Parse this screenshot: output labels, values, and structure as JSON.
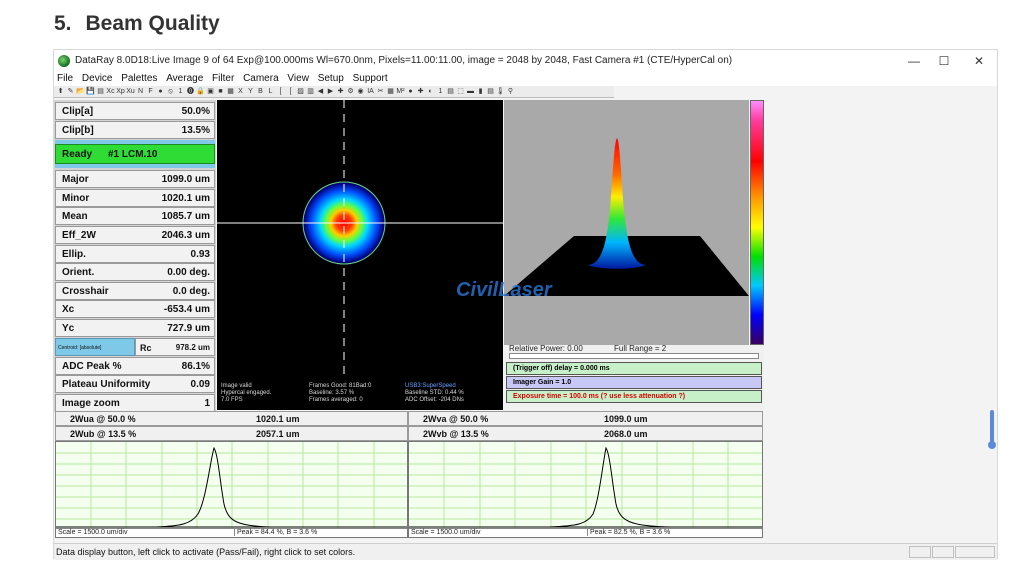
{
  "section": {
    "number": "5.",
    "title": "Beam Quality"
  },
  "window": {
    "title": "DataRay 8.0D18:Live Image 9 of 64    Exp@100.000ms     Wl=670.0nm, Pixels=11.00:11.00, image = 2048 by 2048, Fast   Camera #1  (CTE/HyperCal on)",
    "minimize": "—",
    "maximize": "☐",
    "close": "✕"
  },
  "menu": [
    "File",
    "Device",
    "Palettes",
    "Average",
    "Filter",
    "Camera",
    "View",
    "Setup",
    "Support"
  ],
  "toolbar_icons": [
    "arrow-up-icon",
    "pencil-icon",
    "open-icon",
    "save-icon",
    "print-icon",
    "xc-icon",
    "xp-icon",
    "xu-icon",
    "n-icon",
    "f-icon",
    "record-icon",
    "stop-icon",
    "one-icon",
    "info-icon",
    "lock-icon",
    "camera-icon",
    "green-square-icon",
    "grid-icon",
    "x-icon",
    "y-icon",
    "b-icon",
    "l-icon",
    "bracket-icon",
    "bracket2-icon",
    "image-icon",
    "chart-icon",
    "back-icon",
    "forward-icon",
    "plus-icon",
    "tools-icon",
    "circle-icon",
    "ia-icon",
    "cut-icon",
    "grid2-icon",
    "m2-icon",
    "red-icon",
    "target-icon",
    "beam-icon",
    "one2-icon",
    "meter-icon",
    "select-icon",
    "palette-icon",
    "bars-icon",
    "stack-icon",
    "thermo-icon",
    "pin-icon"
  ],
  "toolbar_glyphs": [
    "⬆",
    "✎",
    "📂",
    "💾",
    "▤",
    "Xc",
    "Xp",
    "Xu",
    "N",
    "F",
    "●",
    "⦸",
    "1",
    "⓿",
    "🔒",
    "▣",
    "■",
    "▦",
    "X",
    "Y",
    "B",
    "L",
    "[",
    "[",
    "▨",
    "▥",
    "◀",
    "▶",
    "✚",
    "⚙",
    "◉",
    "IA",
    "✂",
    "▦",
    "M²",
    "●",
    "✚",
    "◐",
    "1",
    "▤",
    "⬚",
    "▬",
    "▮",
    "▤",
    "🌡",
    "⚲"
  ],
  "results": [
    {
      "label": "Clip[a]",
      "value": "50.0%"
    },
    {
      "label": "Clip[b]",
      "value": "13.5%"
    }
  ],
  "status": {
    "label": "Ready",
    "detail": "#1 LCM.10"
  },
  "measurements": [
    {
      "label": "Major",
      "value": "1099.0 um"
    },
    {
      "label": "Minor",
      "value": "1020.1 um"
    },
    {
      "label": "Mean",
      "value": "1085.7 um"
    },
    {
      "label": "Eff_2W",
      "value": "2046.3 um"
    },
    {
      "label": "Ellip.",
      "value": "0.93"
    },
    {
      "label": "Orient.",
      "value": "0.00 deg."
    },
    {
      "label": "Crosshair",
      "value": "0.0 deg."
    },
    {
      "label": "Xc",
      "value": "-653.4 um"
    },
    {
      "label": "Yc",
      "value": "727.9 um"
    }
  ],
  "centroid": {
    "label": "Centroid: [absolute]",
    "rc_label": "Rc",
    "rc_value": "978.2 um"
  },
  "extra": [
    {
      "label": "ADC Peak %",
      "value": "86.1%"
    },
    {
      "label": "Plateau Uniformity",
      "value": "0.09"
    },
    {
      "label": "Image zoom",
      "value": "1"
    }
  ],
  "image_stats": {
    "col1": [
      "Image valid",
      "Hypercal engaged.",
      "7.0 FPS"
    ],
    "col2": [
      "Frames Good: 81Bad:0",
      "Baseline: 3.57 %",
      "Frames averaged: 0"
    ],
    "col3": [
      "USB3:SuperSpeed",
      "Baseline STD:  0.44 %",
      "ADC Offset: -204 DNs"
    ]
  },
  "watermark": "CivilLaser",
  "power": {
    "relative": "Relative Power: 0.00",
    "full_range": "Full Range = 2"
  },
  "controls": {
    "trigger": "(Trigger off) delay = 0.000 ms",
    "gain": "Imager Gain = 1.0",
    "exposure": "Exposure time = 100.0 ms    (?  use less attenuation ?)"
  },
  "widths": [
    {
      "label": "2Wua @ 50.0 %",
      "value": "1020.1 um"
    },
    {
      "label": "2Wub @ 13.5 %",
      "value": "2057.1 um"
    },
    {
      "label": "2Wva @ 50.0 %",
      "value": "1099.0 um"
    },
    {
      "label": "2Wvb @ 13.5 %",
      "value": "2068.0 um"
    }
  ],
  "profiles": [
    {
      "scale": "Scale = 1500.0 um/div",
      "peak": "Peak = 84.4 %,  B = 3.6 %"
    },
    {
      "scale": "Scale = 1500.0 um/div",
      "peak": "Peak = 82.5 %,  B = 3.6 %"
    }
  ],
  "statusbar": "Data display button, left click to activate (Pass/Fail), right click to set colors.",
  "colors": {
    "ready": "#2fdc36",
    "centroid": "#7ec8e8",
    "gain": "#c8c8f6",
    "trigger": "#c8f0c8",
    "warning": "#d00000",
    "profile_bg": "#f5fff0"
  }
}
